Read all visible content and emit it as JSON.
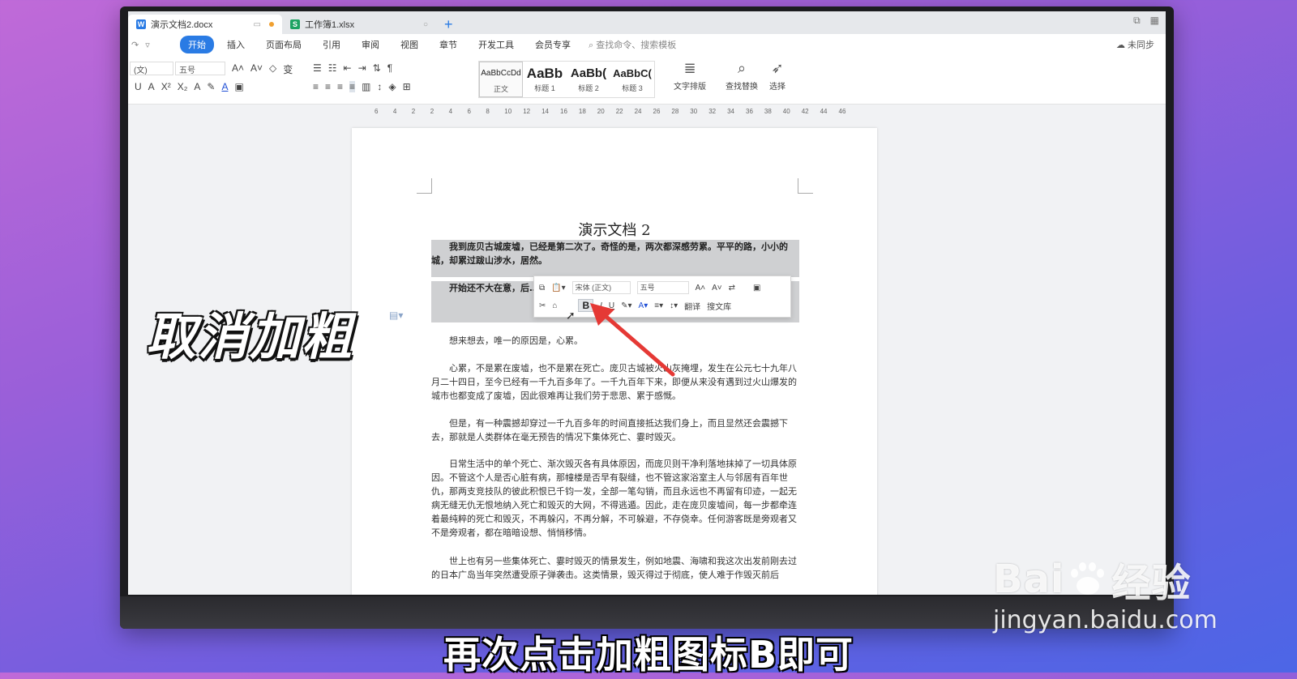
{
  "tabs": [
    {
      "label": "演示文档2.docx",
      "icon": "W",
      "color": "#2a7be4",
      "active": true
    },
    {
      "label": "工作簿1.xlsx",
      "icon": "S",
      "color": "#1ea362",
      "active": false
    }
  ],
  "menu": {
    "items": [
      "开始",
      "插入",
      "页面布局",
      "引用",
      "审阅",
      "视图",
      "章节",
      "开发工具",
      "会员专享"
    ],
    "active": "开始",
    "search_placeholder": "查找命令、搜索模板",
    "sync_label": "未同步"
  },
  "ribbon": {
    "font_name": "(文)",
    "font_size": "五号",
    "styles": [
      {
        "preview": "AaBbCcDd",
        "label": "正文"
      },
      {
        "preview": "AaBb",
        "label": "标题 1"
      },
      {
        "preview": "AaBb(",
        "label": "标题 2"
      },
      {
        "preview": "AaBbC(",
        "label": "标题 3"
      }
    ],
    "text_layout_label": "文字排版",
    "find_replace_label": "查找替换",
    "select_label": "选择"
  },
  "ruler_ticks": [
    "6",
    "4",
    "2",
    "2",
    "4",
    "6",
    "8",
    "10",
    "12",
    "14",
    "16",
    "18",
    "20",
    "22",
    "24",
    "26",
    "28",
    "30",
    "32",
    "34",
    "36",
    "38",
    "40",
    "42",
    "44",
    "46"
  ],
  "document": {
    "title": "演示文档 2",
    "paragraphs": [
      "我到庞贝古城废墟，已经是第二次了。奇怪的是，两次都深感劳累。平平的路，小小的城，却累过跋山涉水，居然。",
      "开始还不大在意，后……上次也在这里找过。……动在前年和今年的阳光下。",
      "想来想去，唯一的原因是，心累。",
      "心累，不是累在废墟，也不是累在死亡。庞贝古城被火山灰掩埋，发生在公元七十九年八月二十四日，至今已经有一千九百多年了。一千九百年下来，即便从来没有遇到过火山爆发的城市也都变成了废墟，因此很难再让我们劳于悲思、累于感慨。",
      "但是，有一种震撼却穿过一千九百多年的时间直接抵达我们身上，而且显然还会震撼下去，那就是人类群体在毫无预告的情况下集体死亡、霎时毁灭。",
      "日常生活中的单个死亡、渐次毁灭各有具体原因，而庞贝则干净利落地抹掉了一切具体原因。不管这个人是否心脏有病，那幢楼是否早有裂缝，也不管这家浴室主人与邻居有百年世仇，那两支竞技队的彼此积恨已千钧一发，全部一笔勾销，而且永远也不再留有印迹，一起无病无缝无仇无恨地纳入死亡和毁灭的大网，不得逃遁。因此，走在庞贝废墟间，每一步都牵连着最纯粹的死亡和毁灭，不再躲闪，不再分解，不可躲避，不存侥幸。任何游客既是旁观者又不是旁观者，都在暗暗设想、悄悄移情。",
      "世上也有另一些集体死亡、霎时毁灭的情景发生，例如地震、海啸和我这次出发前刚去过的日本广岛当年突然遭受原子弹袭击。这类情景，毁灭得过于彻底，使人难于作毁灭前后"
    ]
  },
  "mini_toolbar": {
    "font": "宋体 (正文)",
    "size": "五号",
    "translate_label": "翻译",
    "search_doc_label": "搜文库"
  },
  "overlay": {
    "caption": "取消加粗",
    "subtitle": "再次点击加粗图标B即可",
    "watermark_main": "Bai",
    "watermark_suffix": "经验",
    "watermark_url": "jingyan.baidu.com"
  },
  "colors": {
    "accent": "#2a7be4",
    "arrow": "#e53935"
  }
}
